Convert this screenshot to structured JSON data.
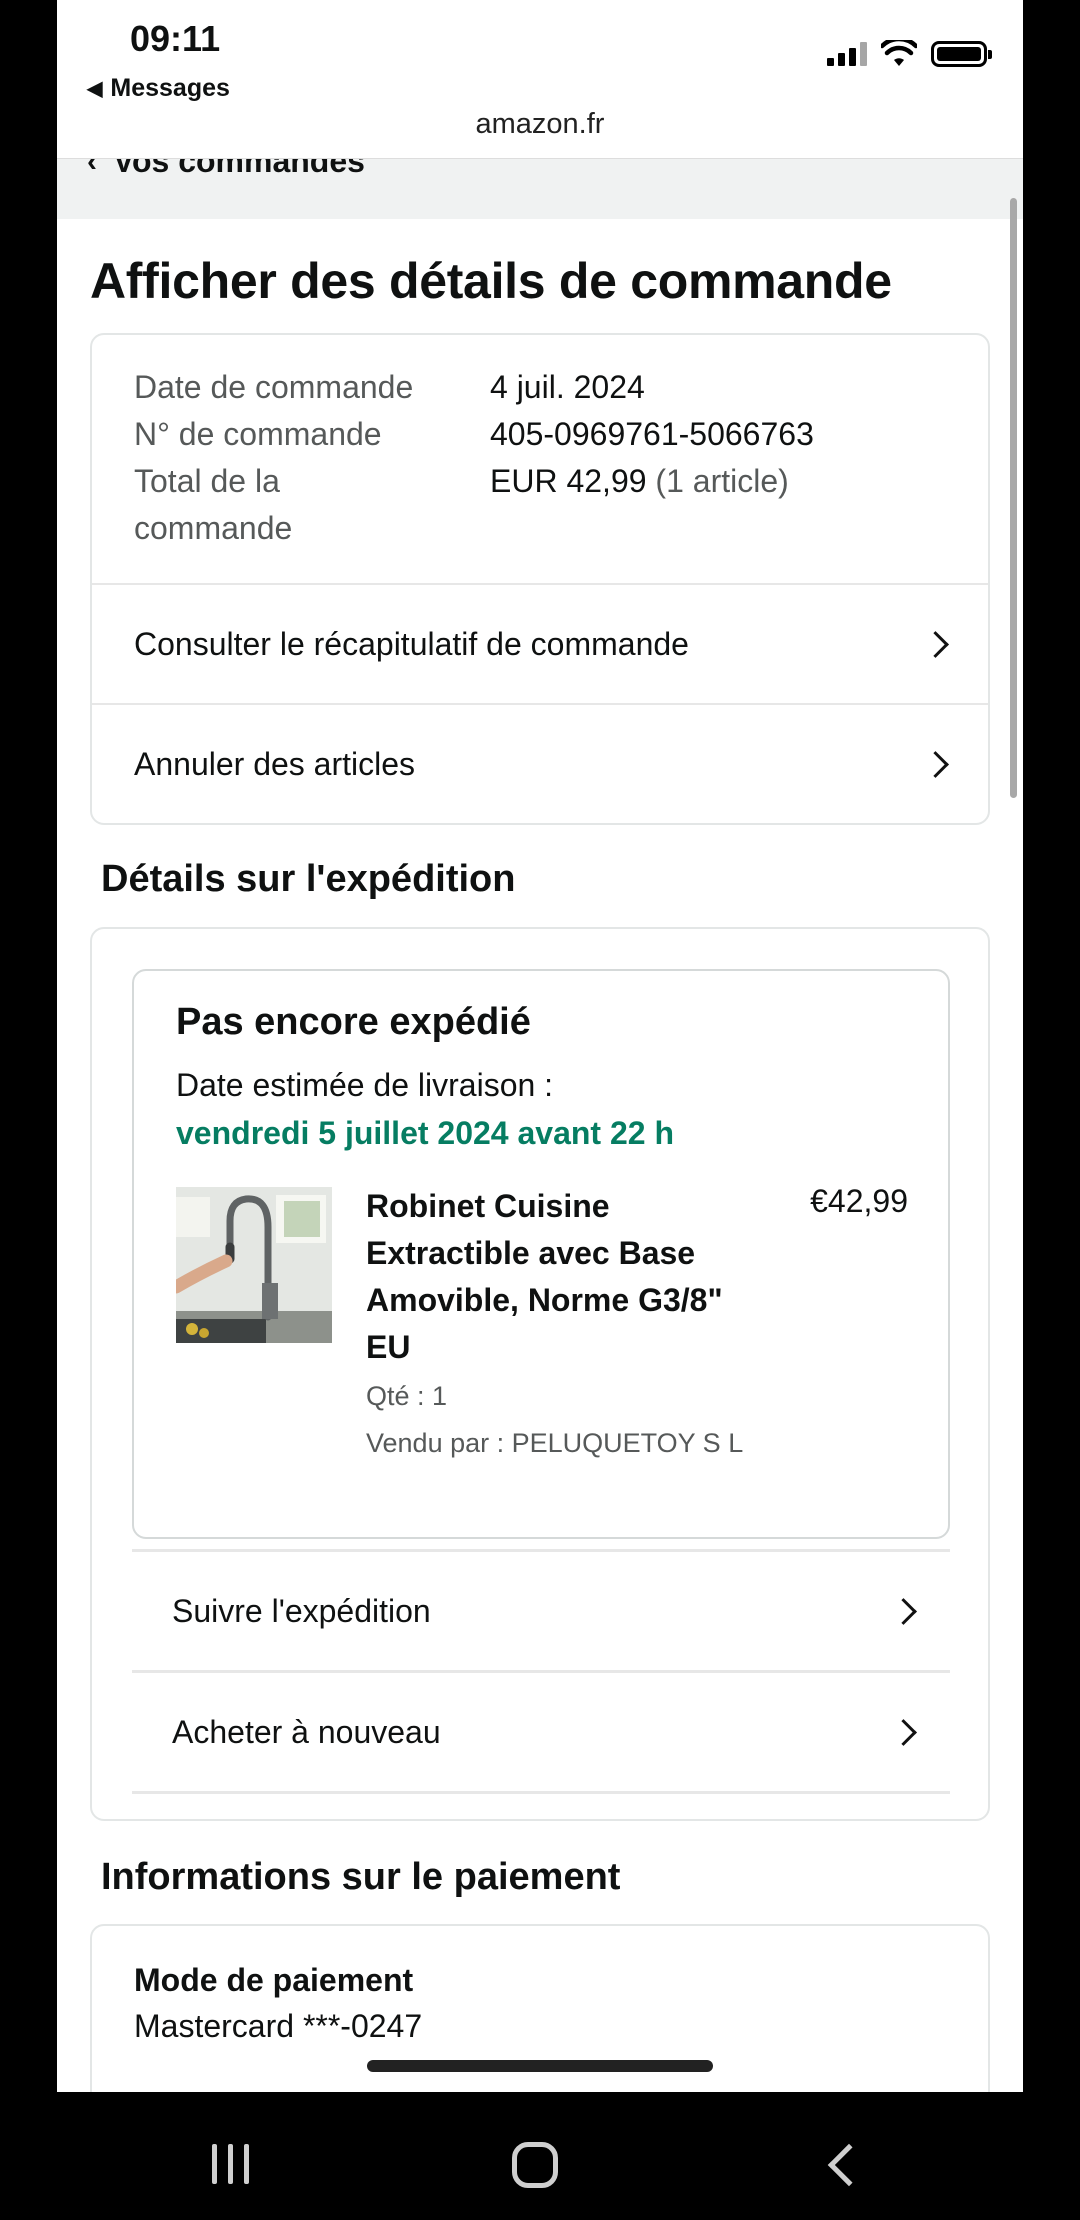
{
  "status_bar": {
    "time": "09:11",
    "back_app": "Messages",
    "url": "amazon.fr"
  },
  "breadcrumb": {
    "label": "Vos commandes"
  },
  "page_title": "Afficher des détails de commande",
  "order_summary": {
    "date_label": "Date de commande",
    "date_value": "4 juil. 2024",
    "number_label": "N° de commande",
    "number_value": "405-0969761-5066763",
    "total_label_line1": "Total de la",
    "total_label_line2": "commande",
    "total_value": "EUR 42,99",
    "total_items": "(1 article)"
  },
  "order_actions": {
    "recap": "Consulter le récapitulatif de commande",
    "cancel": "Annuler des articles"
  },
  "shipping": {
    "section_title": "Détails sur l'expédition",
    "status": "Pas encore expédié",
    "estimated_label": "Date estimée de livraison :",
    "estimated_date": "vendredi 5 juillet 2024 avant 22 h",
    "product": {
      "title": "Robinet Cuisine Extractible avec Base Amovible, Norme G3/8\" EU",
      "price": "€42,99",
      "qty": "Qté : 1",
      "seller": "Vendu par : PELUQUETOY S L"
    },
    "track": "Suivre l'expédition",
    "buy_again": "Acheter à nouveau"
  },
  "payment": {
    "section_title": "Informations sur le paiement",
    "method_label": "Mode de paiement",
    "method_value": "Mastercard ***-0247"
  },
  "colors": {
    "delivery_green": "#067d62",
    "muted_text": "#565959",
    "breadcrumb_bg": "#f0f2f2"
  }
}
